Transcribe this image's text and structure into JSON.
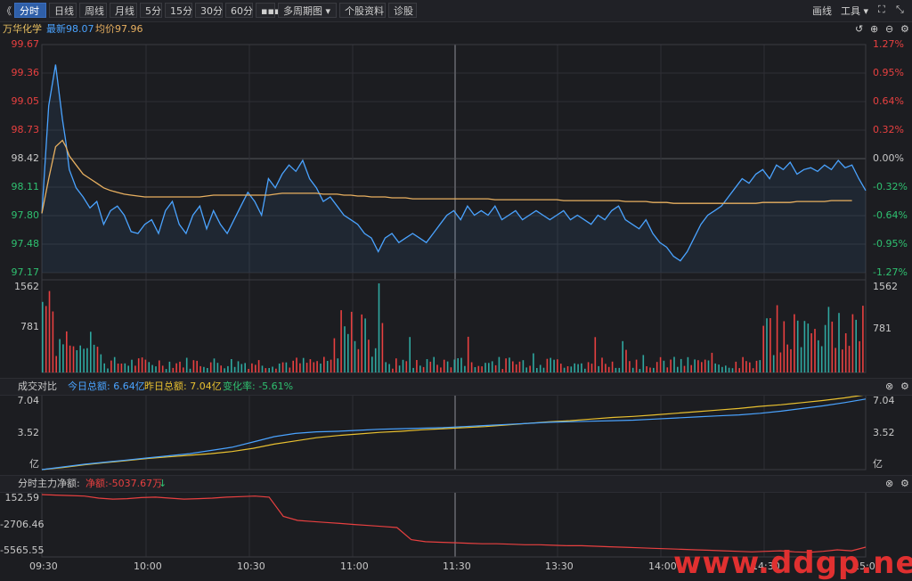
{
  "toolbar": {
    "back": "《",
    "tabs": [
      "分时",
      "日线",
      "周线",
      "月线",
      "5分",
      "15分",
      "30分",
      "60分",
      "▪▪▪",
      "多周期图 ▾",
      "个股资料",
      "诊股"
    ],
    "right": {
      "draw": "画线",
      "tools": "工具 ▾",
      "expand": "⛶",
      "shrink": "⤡"
    }
  },
  "stock": {
    "name": "万华化学",
    "latest_label": "最新98.07",
    "avg_label": "均价97.96"
  },
  "price_axis": {
    "left": [
      "99.67",
      "99.36",
      "99.05",
      "98.73",
      "98.42",
      "98.11",
      "97.80",
      "97.48",
      "97.17"
    ],
    "right": [
      "1.27%",
      "0.95%",
      "0.64%",
      "0.32%",
      "0.00%",
      "-0.32%",
      "-0.64%",
      "-0.95%",
      "-1.27%"
    ]
  },
  "volume_axis": {
    "left": [
      "1562",
      "781"
    ],
    "right": [
      "1562",
      "781"
    ]
  },
  "panel_compare": {
    "title": "成交对比",
    "today": "今日总额: 6.64亿",
    "yesterday": "昨日总额: 7.04亿",
    "change": "变化率: -5.61%",
    "axis_left": [
      "7.04",
      "3.52",
      "亿"
    ],
    "axis_right": [
      "7.04",
      "3.52",
      "亿"
    ]
  },
  "panel_flow": {
    "title": "分时主力净额:",
    "net": "净额:-5037.67万",
    "arrow": "↓",
    "axis_left": [
      "152.59",
      "-2706.46",
      "-5565.55"
    ]
  },
  "time_axis": [
    "09:30",
    "10:00",
    "10:30",
    "11:00",
    "11:30",
    "13:30",
    "14:00",
    "14:30",
    "15:00"
  ],
  "watermark": "www.ddgp.net",
  "colors": {
    "price": "#4aa3ff",
    "avg": "#e8b060",
    "up": "#e84040",
    "down": "#2fa8a0",
    "yesterday": "#e8c030",
    "flow": "#e84040"
  },
  "chart_data": {
    "type": "line",
    "price_range": [
      97.17,
      99.67
    ],
    "price_x": [
      0,
      2,
      4,
      6,
      7,
      8,
      10,
      12,
      14,
      16,
      18,
      20,
      22,
      24,
      26,
      28,
      30,
      32,
      34,
      36,
      38,
      40,
      42,
      44,
      46,
      48,
      50,
      52,
      54,
      56,
      58,
      60,
      62,
      64,
      66,
      68,
      70,
      72,
      74,
      76,
      78,
      80,
      82,
      84,
      86,
      88,
      90,
      92,
      94,
      96,
      98,
      100,
      102,
      104,
      106,
      108,
      110,
      112,
      114,
      116,
      118,
      120,
      122,
      124,
      126,
      128,
      130,
      132,
      134,
      136,
      138,
      140,
      142,
      144,
      146,
      148,
      150,
      152,
      154,
      156,
      158,
      160,
      162,
      164,
      166,
      168,
      170,
      172,
      174,
      176,
      178,
      180,
      182,
      184,
      186,
      188,
      190,
      192,
      194,
      196,
      198,
      200,
      202,
      204,
      206,
      208,
      210,
      212,
      214,
      216,
      218,
      220,
      222,
      224,
      226,
      228,
      230,
      232,
      234,
      236,
      238,
      240
    ],
    "price": [
      97.82,
      99.0,
      99.45,
      98.85,
      98.6,
      98.3,
      98.1,
      98.0,
      97.88,
      97.95,
      97.7,
      97.85,
      97.9,
      97.8,
      97.62,
      97.6,
      97.7,
      97.75,
      97.6,
      97.85,
      97.95,
      97.7,
      97.6,
      97.8,
      97.9,
      97.65,
      97.85,
      97.7,
      97.6,
      97.75,
      97.9,
      98.05,
      97.95,
      97.8,
      98.2,
      98.1,
      98.25,
      98.35,
      98.28,
      98.4,
      98.2,
      98.1,
      97.95,
      98.0,
      97.9,
      97.8,
      97.75,
      97.7,
      97.6,
      97.55,
      97.4,
      97.55,
      97.6,
      97.5,
      97.55,
      97.6,
      97.55,
      97.5,
      97.6,
      97.7,
      97.8,
      97.85,
      97.75,
      97.9,
      97.8,
      97.85,
      97.8,
      97.9,
      97.75,
      97.8,
      97.85,
      97.75,
      97.8,
      97.85,
      97.8,
      97.75,
      97.8,
      97.85,
      97.75,
      97.8,
      97.75,
      97.7,
      97.8,
      97.75,
      97.85,
      97.9,
      97.75,
      97.7,
      97.65,
      97.75,
      97.6,
      97.5,
      97.45,
      97.35,
      97.3,
      97.4,
      97.55,
      97.7,
      97.8,
      97.85,
      97.9,
      98.0,
      98.1,
      98.2,
      98.15,
      98.25,
      98.3,
      98.2,
      98.35,
      98.3,
      98.38,
      98.25,
      98.3,
      98.32,
      98.28,
      98.35,
      98.3,
      98.4,
      98.32,
      98.35,
      98.2,
      98.07
    ],
    "avg": [
      97.82,
      98.2,
      98.55,
      98.62,
      98.55,
      98.45,
      98.35,
      98.25,
      98.2,
      98.15,
      98.1,
      98.07,
      98.05,
      98.03,
      98.02,
      98.01,
      98.0,
      98.0,
      98.0,
      98.0,
      98.0,
      98.0,
      98.0,
      98.0,
      98.0,
      98.01,
      98.02,
      98.02,
      98.02,
      98.02,
      98.02,
      98.02,
      98.02,
      98.02,
      98.02,
      98.03,
      98.04,
      98.04,
      98.04,
      98.04,
      98.04,
      98.04,
      98.03,
      98.03,
      98.03,
      98.02,
      98.02,
      98.01,
      98.01,
      98.0,
      98.0,
      98.0,
      97.99,
      97.99,
      97.99,
      97.98,
      97.98,
      97.98,
      97.98,
      97.98,
      97.98,
      97.98,
      97.98,
      97.98,
      97.98,
      97.98,
      97.98,
      97.97,
      97.97,
      97.97,
      97.97,
      97.97,
      97.97,
      97.97,
      97.97,
      97.97,
      97.97,
      97.96,
      97.96,
      97.96,
      97.96,
      97.96,
      97.96,
      97.96,
      97.96,
      97.96,
      97.95,
      97.95,
      97.95,
      97.95,
      97.94,
      97.94,
      97.94,
      97.93,
      97.93,
      97.93,
      97.93,
      97.93,
      97.93,
      97.93,
      97.93,
      97.93,
      97.93,
      97.93,
      97.93,
      97.93,
      97.94,
      97.94,
      97.94,
      97.94,
      97.94,
      97.95,
      97.95,
      97.95,
      97.95,
      97.95,
      97.96,
      97.96,
      97.96,
      97.96
    ],
    "compare_range": [
      0,
      7.04
    ],
    "today_cum": [
      0,
      0.25,
      0.5,
      0.7,
      0.9,
      1.1,
      1.3,
      1.5,
      1.8,
      2.1,
      2.6,
      3.1,
      3.4,
      3.55,
      3.6,
      3.7,
      3.8,
      3.85,
      3.9,
      3.95,
      4.05,
      4.15,
      4.25,
      4.35,
      4.45,
      4.5,
      4.55,
      4.6,
      4.65,
      4.75,
      4.85,
      4.95,
      5.05,
      5.15,
      5.3,
      5.5,
      5.75,
      6.0,
      6.3,
      6.64
    ],
    "yesterday_cum": [
      0,
      0.2,
      0.45,
      0.65,
      0.85,
      1.05,
      1.2,
      1.35,
      1.5,
      1.7,
      2.0,
      2.4,
      2.7,
      3.0,
      3.2,
      3.35,
      3.5,
      3.6,
      3.75,
      3.85,
      3.95,
      4.05,
      4.2,
      4.35,
      4.5,
      4.6,
      4.75,
      4.9,
      5.0,
      5.15,
      5.3,
      5.45,
      5.6,
      5.75,
      5.95,
      6.1,
      6.3,
      6.5,
      6.75,
      7.04
    ],
    "flow_range": [
      -5565.55,
      152.59
    ],
    "flow": [
      152.59,
      100,
      60,
      0,
      -200,
      -300,
      -250,
      -150,
      -100,
      -200,
      -300,
      -250,
      -200,
      -100,
      -50,
      0,
      -100,
      -2000,
      -2400,
      -2500,
      -2600,
      -2700,
      -2800,
      -2900,
      -3000,
      -3100,
      -4300,
      -4500,
      -4550,
      -4600,
      -4650,
      -4700,
      -4700,
      -4750,
      -4800,
      -4800,
      -4850,
      -4900,
      -4900,
      -4950,
      -5000,
      -5050,
      -5100,
      -5150,
      -5200,
      -5250,
      -5300,
      -5350,
      -5400,
      -5450,
      -5500,
      -5450,
      -5400,
      -5500,
      -5550,
      -5450,
      -5300,
      -5400,
      -5037.67
    ]
  }
}
